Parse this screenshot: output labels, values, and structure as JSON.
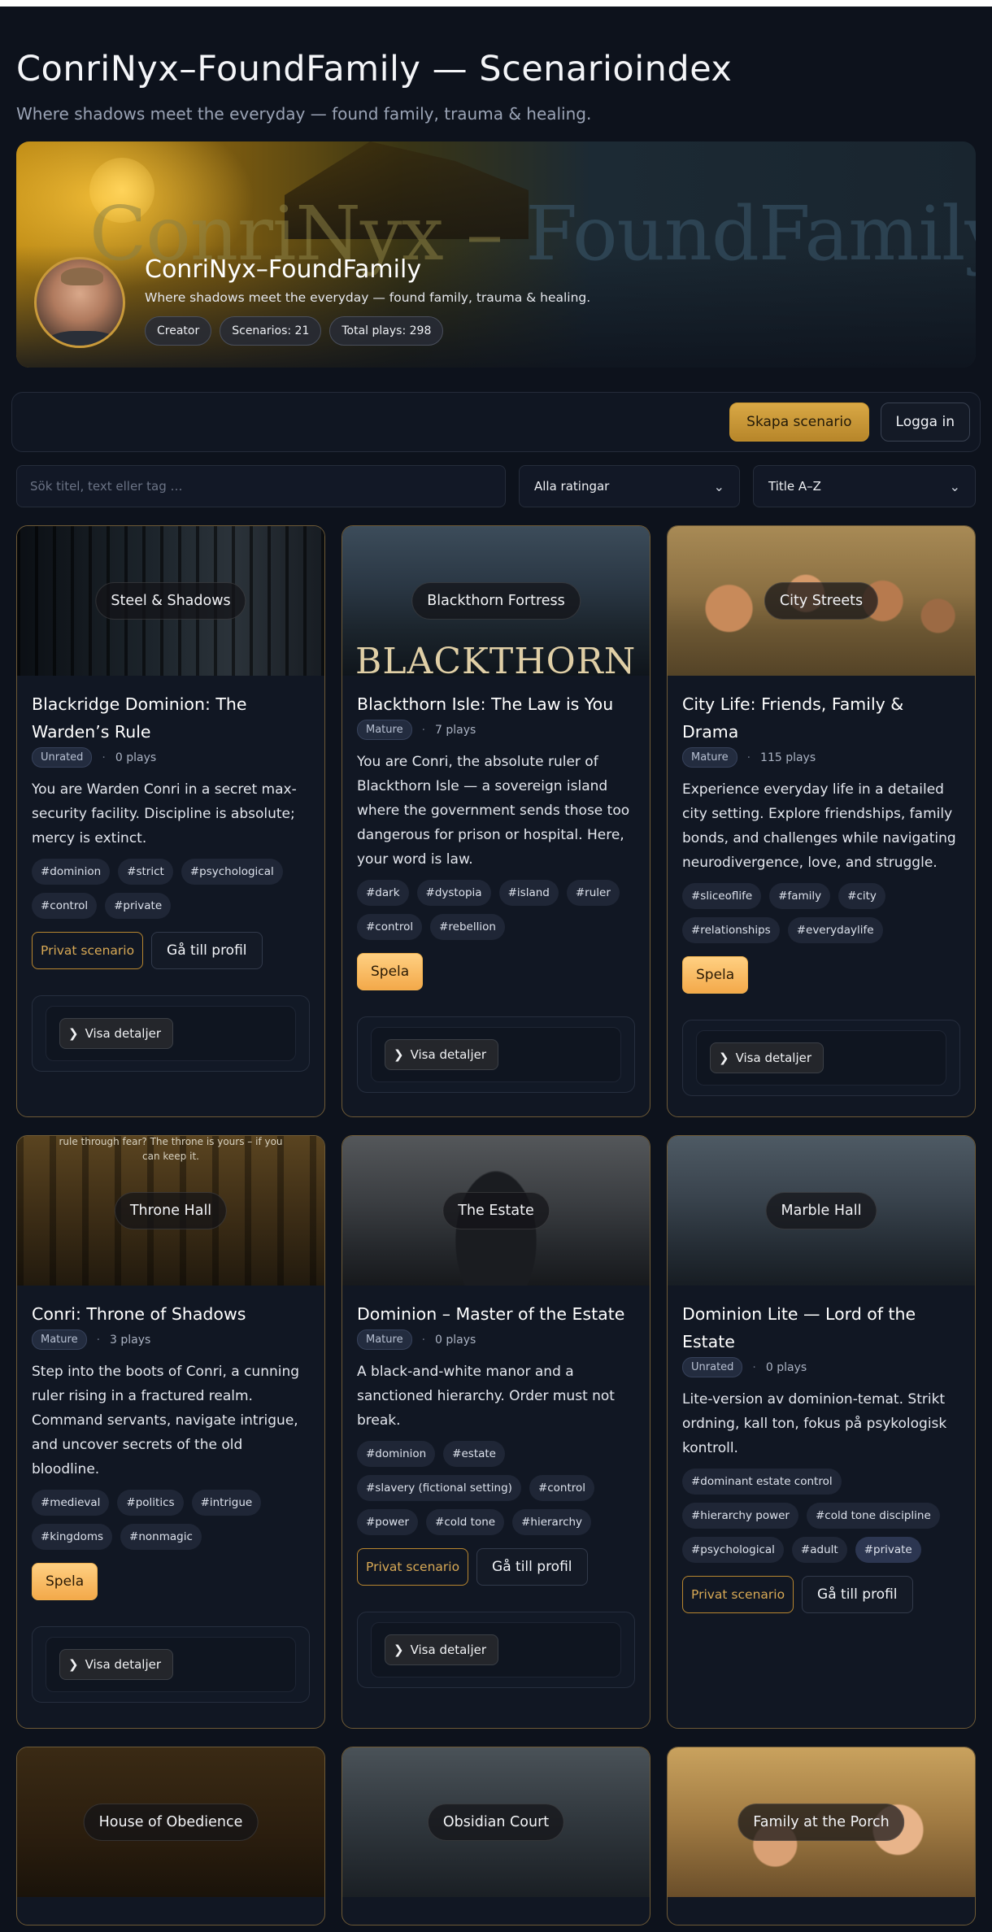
{
  "header": {
    "title": "ConriNyx–FoundFamily — Scenarioindex",
    "subtitle": "Where shadows meet the everyday — found family, trauma & healing."
  },
  "profile": {
    "watermark_left": "ConriNyx",
    "watermark_dash": " – ",
    "watermark_right": "FoundFamily",
    "name": "ConriNyx–FoundFamily",
    "tagline": "Where shadows meet the everyday — found family, trauma & healing.",
    "badges": [
      "Creator",
      "Scenarios: 21",
      "Total plays: 298"
    ]
  },
  "actions": {
    "create_label": "Skapa scenario",
    "login_label": "Logga in"
  },
  "filters": {
    "search_placeholder": "Sök titel, text eller tag …",
    "rating_value": "Alla ratingar",
    "sort_value": "Title A–Z"
  },
  "labels": {
    "private": "Privat scenario",
    "profile": "Gå till profil",
    "play": "Spela",
    "details": "Visa detaljer"
  },
  "cards": [
    {
      "media_label": "Steel & Shadows",
      "title": "Blackridge Dominion: The Warden’s Rule",
      "rating": "Unrated",
      "plays": "0 plays",
      "desc": "You are Warden Conri in a secret max-security facility. Discipline is absolute; mercy is extinct.",
      "tags": [
        "#dominion",
        "#strict",
        "#psychological",
        "#control",
        "#private"
      ]
    },
    {
      "media_label": "Blackthorn Fortress",
      "media_caption": "BLACKTHORN",
      "title": "Blackthorn Isle: The Law is You",
      "rating": "Mature",
      "plays": "7 plays",
      "desc": "You are Conri, the absolute ruler of Blackthorn Isle — a sovereign island where the government sends those too dangerous for prison or hospital. Here, your word is law.",
      "tags": [
        "#dark",
        "#dystopia",
        "#island",
        "#ruler",
        "#control",
        "#rebellion"
      ]
    },
    {
      "media_label": "City Streets",
      "title": "City Life: Friends, Family & Drama",
      "rating": "Mature",
      "plays": "115 plays",
      "desc": "Experience everyday life in a detailed city setting. Explore friendships, family bonds, and challenges while navigating neurodivergence, love, and struggle.",
      "tags": [
        "#sliceoflife",
        "#family",
        "#city",
        "#relationships",
        "#everydaylife"
      ]
    },
    {
      "media_label": "Throne Hall",
      "media_caption": "rule through fear? The throne is yours – if you can keep it.",
      "title": "Conri: Throne of Shadows",
      "rating": "Mature",
      "plays": "3 plays",
      "desc": "Step into the boots of Conri, a cunning ruler rising in a fractured realm. Command servants, navigate intrigue, and uncover secrets of the old bloodline.",
      "tags": [
        "#medieval",
        "#politics",
        "#intrigue",
        "#kingdoms",
        "#nonmagic"
      ]
    },
    {
      "media_label": "The Estate",
      "title": "Dominion – Master of the Estate",
      "rating": "Mature",
      "plays": "0 plays",
      "desc": "A black-and-white manor and a sanctioned hierarchy. Order must not break.",
      "tags": [
        "#dominion",
        "#estate",
        "#slavery (fictional setting)",
        "#control",
        "#power",
        "#cold tone",
        "#hierarchy"
      ]
    },
    {
      "media_label": "Marble Hall",
      "title": "Dominion Lite — Lord of the Estate",
      "rating": "Unrated",
      "plays": "0 plays",
      "desc": "Lite-version av dominion-temat. Strikt ordning, kall ton, fokus på psykologisk kontroll.",
      "tags": [
        "#dominant estate control",
        "#hierarchy power",
        "#cold tone discipline",
        "#psychological",
        "#adult",
        "#private"
      ]
    },
    {
      "media_label": "House of Obedience"
    },
    {
      "media_label": "Obsidian Court"
    },
    {
      "media_label": "Family at the Porch"
    }
  ],
  "colors": {
    "accent": "#d9a845",
    "play": "#f3a94a",
    "card_border": "#6e5a36",
    "background": "#0d121c"
  }
}
